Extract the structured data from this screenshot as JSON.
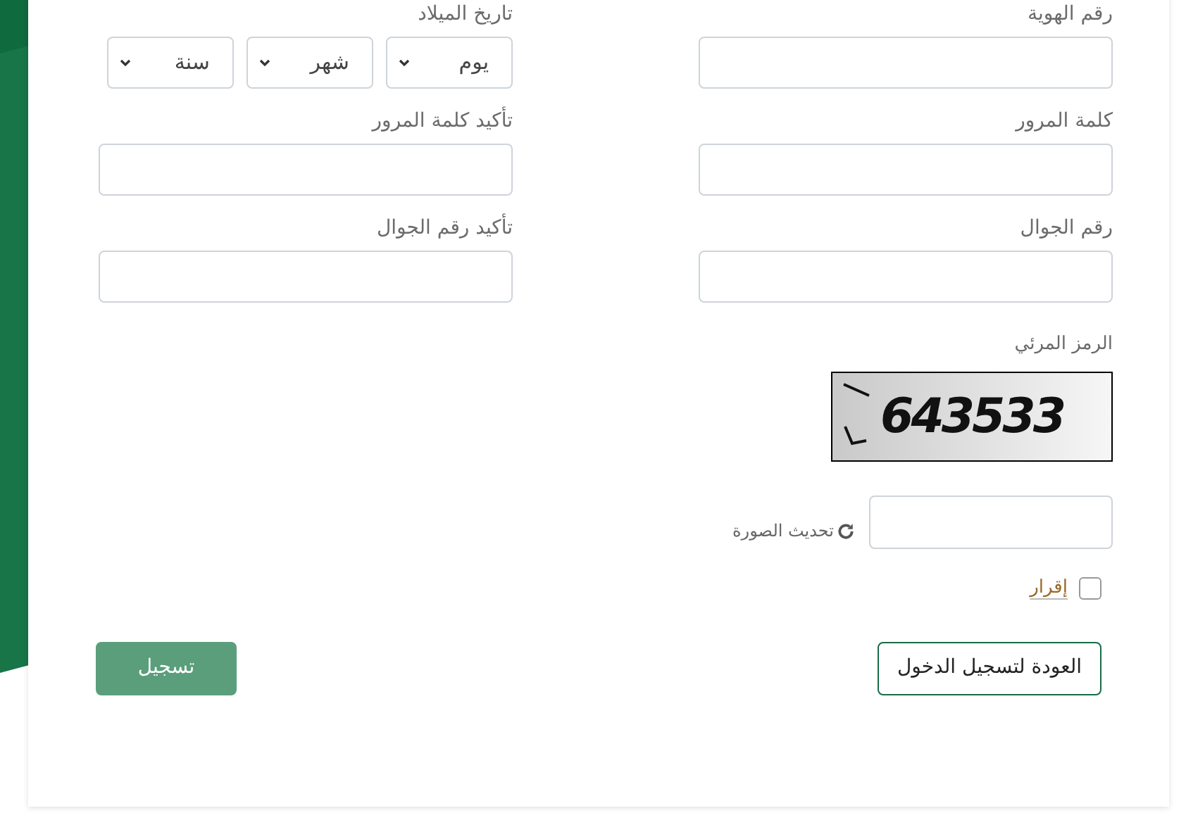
{
  "form": {
    "fields": [
      {
        "kind": "text",
        "label": "رقم الهوية"
      },
      {
        "kind": "date",
        "label": "تاريخ الميلاد",
        "selects": [
          "يوم",
          "شهر",
          "سنة"
        ]
      },
      {
        "kind": "text",
        "label": "كلمة المرور"
      },
      {
        "kind": "text",
        "label": "تأكيد كلمة المرور"
      },
      {
        "kind": "text",
        "label": "رقم الجوال"
      },
      {
        "kind": "text",
        "label": "تأكيد رقم الجوال"
      }
    ],
    "captcha": {
      "label": "الرمز المرئي",
      "code": "643533",
      "refresh": "تحديث الصورة"
    },
    "consent": {
      "label": "إقرار",
      "checked": false
    },
    "buttons": [
      {
        "kind": "outline",
        "label": "العودة لتسجيل الدخول"
      },
      {
        "kind": "filled",
        "label": "تسجيل"
      }
    ]
  }
}
